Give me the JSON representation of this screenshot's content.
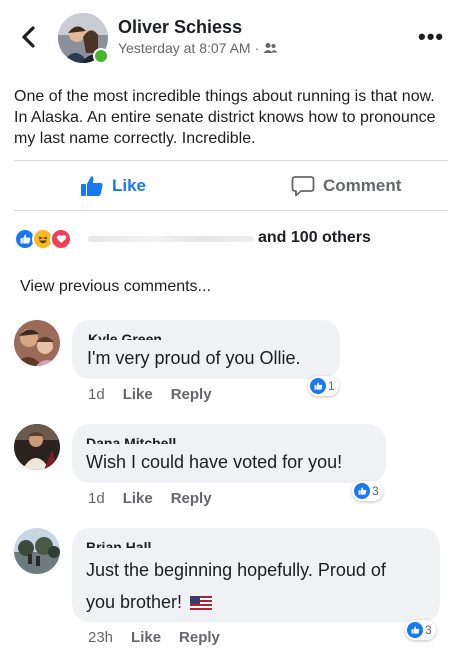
{
  "post": {
    "author": "Oliver Schiess",
    "timestamp": "Yesterday at 8:07 AM",
    "meta_separator": "·",
    "privacy_icon": "friends-icon",
    "body": "One of the most incredible things about running is that now. In Alaska. An entire senate district knows how to pronounce my last name correctly.  Incredible."
  },
  "actions": {
    "like_label": "Like",
    "comment_label": "Comment"
  },
  "reactions": {
    "types": [
      "like",
      "haha",
      "love"
    ],
    "summary_suffix": "and 100 others"
  },
  "comments_section": {
    "view_previous": "View previous comments..."
  },
  "comments": [
    {
      "name_fragment": "Kyle Green",
      "text": "I'm very proud of you Ollie.",
      "time": "1d",
      "like_label": "Like",
      "reply_label": "Reply",
      "reaction_count": "1"
    },
    {
      "name_fragment": "Dana Mitchell",
      "text": "Wish I could have voted for you!",
      "time": "1d",
      "like_label": "Like",
      "reply_label": "Reply",
      "reaction_count": "3"
    },
    {
      "name_fragment": "Brian Hall",
      "text_line1": "Just the beginning hopefully. Proud of",
      "text_line2": "you brother!",
      "time": "23h",
      "like_label": "Like",
      "reply_label": "Reply",
      "reaction_count": "3"
    }
  ],
  "colors": {
    "accent": "#1877f2",
    "secondary_text": "#65676b",
    "bubble": "#eff1f4",
    "online": "#42b72a"
  },
  "more_glyph": "•••"
}
